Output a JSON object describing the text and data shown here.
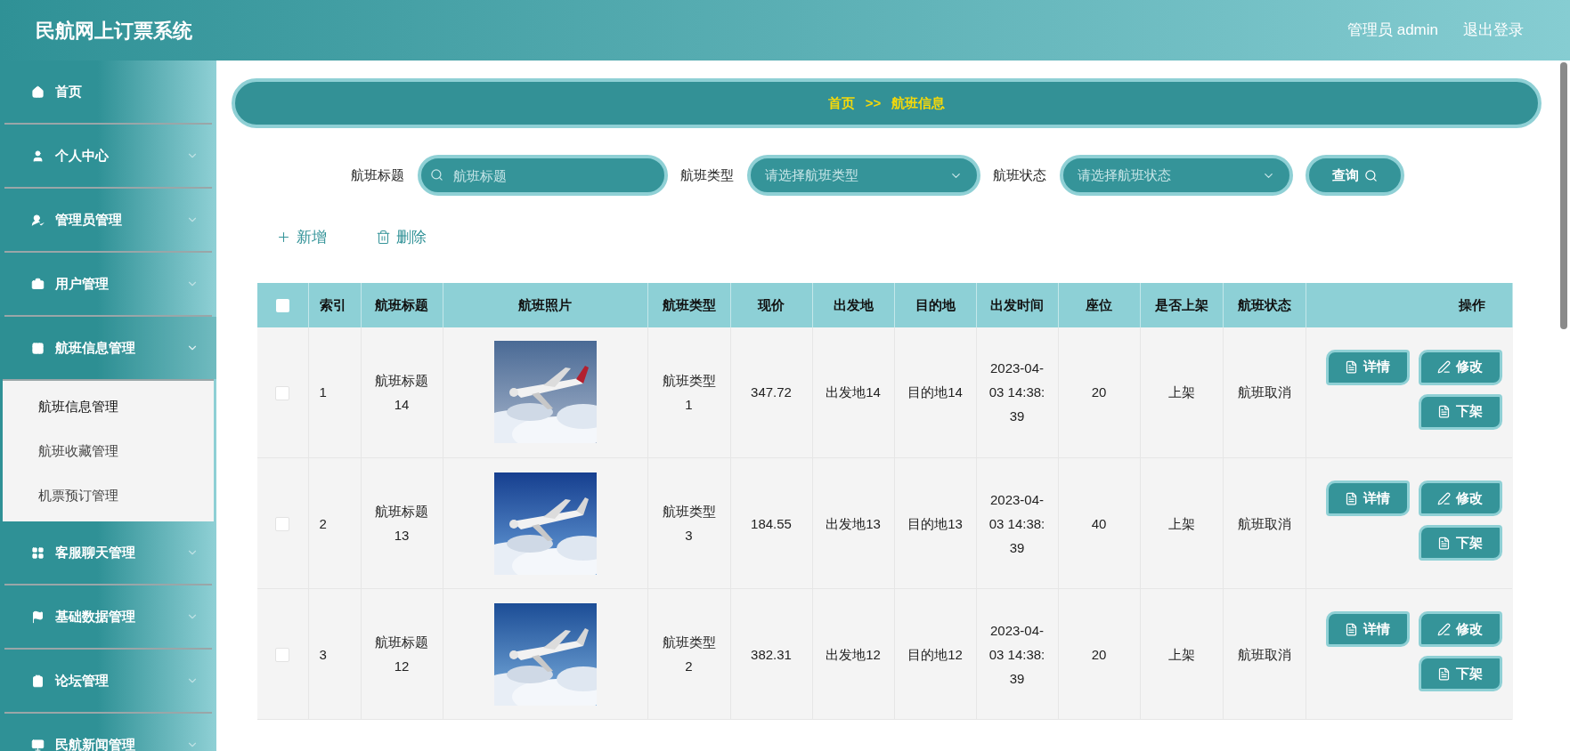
{
  "header": {
    "title": "民航网上订票系统",
    "user": "管理员 admin",
    "logout": "退出登录"
  },
  "sidebar": {
    "items": [
      {
        "label": "首页",
        "kind": "link"
      },
      {
        "label": "个人中心",
        "kind": "menu",
        "expanded": false
      },
      {
        "label": "管理员管理",
        "kind": "menu",
        "expanded": false
      },
      {
        "label": "用户管理",
        "kind": "menu",
        "expanded": false
      },
      {
        "label": "航班信息管理",
        "kind": "menu",
        "expanded": true,
        "children": [
          {
            "label": "航班信息管理",
            "selected": true
          },
          {
            "label": "航班收藏管理",
            "selected": false
          },
          {
            "label": "机票预订管理",
            "selected": false
          }
        ]
      },
      {
        "label": "客服聊天管理",
        "kind": "menu",
        "expanded": false
      },
      {
        "label": "基础数据管理",
        "kind": "menu",
        "expanded": false
      },
      {
        "label": "论坛管理",
        "kind": "menu",
        "expanded": false
      },
      {
        "label": "民航新闻管理",
        "kind": "menu",
        "expanded": false
      }
    ]
  },
  "breadcrumb": [
    "首页",
    "航班信息"
  ],
  "breadcrumb_separator": ">>",
  "search": {
    "fields": [
      {
        "label": "航班标题",
        "kind": "text",
        "placeholder": "航班标题"
      },
      {
        "label": "航班类型",
        "kind": "select",
        "placeholder": "请选择航班类型"
      },
      {
        "label": "航班状态",
        "kind": "select",
        "placeholder": "请选择航班状态"
      }
    ],
    "button": "查询"
  },
  "actions": [
    "新增",
    "删除"
  ],
  "table": {
    "select_all_checked": false,
    "columns": [
      "索引",
      "航班标题",
      "航班照片",
      "航班类型",
      "现价",
      "出发地",
      "目的地",
      "出发时间",
      "座位",
      "是否上架",
      "航班状态",
      "操作"
    ],
    "rows": [
      {
        "checked": false,
        "index": "1",
        "title": "航班标题14",
        "type": "航班类型1",
        "price": "347.72",
        "from": "出发地14",
        "to": "目的地14",
        "time": "2023-04-03 14:38:39",
        "seats": "20",
        "listed": "上架",
        "status": "航班取消",
        "buttons": [
          "详情",
          "修改",
          "下架"
        ]
      },
      {
        "checked": false,
        "index": "2",
        "title": "航班标题13",
        "type": "航班类型3",
        "price": "184.55",
        "from": "出发地13",
        "to": "目的地13",
        "time": "2023-04-03 14:38:39",
        "seats": "40",
        "listed": "上架",
        "status": "航班取消",
        "buttons": [
          "详情",
          "修改",
          "下架"
        ]
      },
      {
        "checked": false,
        "index": "3",
        "title": "航班标题12",
        "type": "航班类型2",
        "price": "382.31",
        "from": "出发地12",
        "to": "目的地12",
        "time": "2023-04-03 14:38:39",
        "seats": "20",
        "listed": "上架",
        "status": "航班取消",
        "buttons": [
          "详情",
          "修改",
          "下架"
        ]
      }
    ]
  }
}
